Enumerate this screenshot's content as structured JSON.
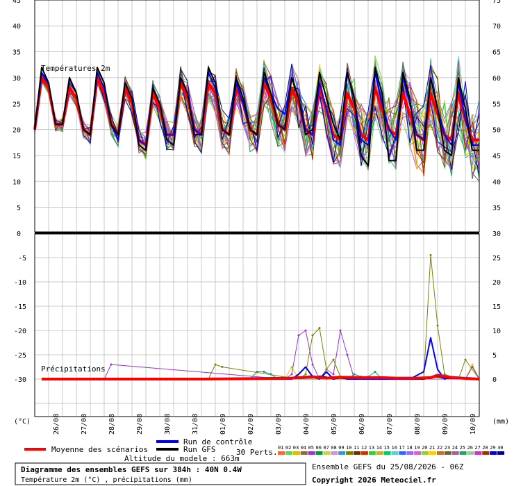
{
  "chart_data": [
    {
      "type": "line",
      "title": "Températures 2m",
      "left_ylim": [
        0,
        45
      ],
      "left_yticks": [
        "0",
        "5",
        "10",
        "15",
        "20",
        "25",
        "30",
        "35",
        "40",
        "45"
      ],
      "right_yticks": [
        "35",
        "40",
        "45",
        "50",
        "55",
        "60",
        "65",
        "70",
        "75"
      ],
      "x_ticks": [
        "26/08",
        "27/08",
        "28/08",
        "29/08",
        "30/08",
        "31/08",
        "01/09",
        "02/09",
        "03/09",
        "04/09",
        "05/09",
        "06/09",
        "07/09",
        "08/09",
        "09/09",
        "10/09"
      ],
      "x_range_h": [
        0,
        384
      ],
      "grid": true,
      "series": [
        {
          "name": "Moyenne des scénarios",
          "color": "#ff0000",
          "x": [
            0,
            6,
            12,
            18,
            24,
            30,
            36,
            42,
            48,
            54,
            60,
            66,
            72,
            78,
            84,
            90,
            96,
            102,
            108,
            114,
            120,
            126,
            132,
            138,
            144,
            150,
            156,
            162,
            168,
            174,
            180,
            186,
            192,
            198,
            204,
            210,
            216,
            222,
            228,
            234,
            240,
            246,
            252,
            258,
            264,
            270,
            276,
            282,
            288,
            294,
            300,
            306,
            312,
            318,
            324,
            330,
            336,
            342,
            348,
            354,
            360,
            366,
            372,
            378,
            384
          ],
          "y": [
            20,
            30,
            28,
            21,
            21,
            28,
            26,
            20,
            19,
            30,
            27,
            21,
            19,
            28,
            25,
            18,
            17,
            27,
            24,
            19,
            19,
            29,
            26,
            20,
            19,
            29,
            27,
            20,
            19,
            28,
            25,
            20,
            19,
            29,
            26,
            21,
            20,
            28,
            25,
            20,
            19,
            28,
            24,
            19,
            18,
            27,
            24,
            19,
            18,
            28,
            24,
            20,
            19,
            27,
            23,
            19,
            18,
            27,
            23,
            19,
            18,
            27,
            22,
            18,
            18
          ]
        },
        {
          "name": "Run de contrôle",
          "color": "#0000ff",
          "x": [
            0,
            6,
            12,
            18,
            24,
            30,
            36,
            42,
            48,
            54,
            60,
            66,
            72,
            78,
            84,
            90,
            96,
            102,
            108,
            114,
            120,
            126,
            132,
            138,
            144,
            150,
            156,
            162,
            168,
            174,
            180,
            186,
            192,
            198,
            204,
            210,
            216,
            222,
            228,
            234,
            240,
            246,
            252,
            258,
            264,
            270,
            276,
            282,
            288,
            294,
            300,
            306,
            312,
            318,
            324,
            330,
            336,
            342,
            348,
            354,
            360,
            366,
            372,
            378,
            384
          ],
          "y": [
            20,
            31,
            29,
            21,
            21,
            30,
            27,
            20,
            19,
            31,
            28,
            21,
            18,
            29,
            26,
            18,
            17,
            28,
            25,
            19,
            19,
            30,
            27,
            20,
            19,
            31,
            28,
            20,
            19,
            29,
            25,
            20,
            19,
            30,
            27,
            24,
            23,
            30,
            26,
            20,
            19,
            29,
            24,
            18,
            17,
            31,
            26,
            18,
            17,
            31,
            25,
            20,
            18,
            30,
            25,
            19,
            18,
            30,
            24,
            19,
            17,
            29,
            22,
            17,
            17
          ]
        },
        {
          "name": "Run GFS",
          "color": "#000000",
          "x": [
            0,
            6,
            12,
            18,
            24,
            30,
            36,
            42,
            48,
            54,
            60,
            66,
            72,
            78,
            84,
            90,
            96,
            102,
            108,
            114,
            120,
            126,
            132,
            138,
            144,
            150,
            156,
            162,
            168,
            174,
            180,
            186,
            192,
            198,
            204,
            210,
            216,
            222,
            228,
            234,
            240,
            246,
            252,
            258,
            264,
            270,
            276,
            282,
            288,
            294,
            300,
            306,
            312,
            318,
            324,
            330,
            336,
            342,
            348,
            354,
            360,
            366,
            372,
            378,
            384
          ],
          "y": [
            20,
            32,
            29,
            21,
            21,
            30,
            27,
            20,
            19,
            32,
            29,
            21,
            19,
            29,
            26,
            17,
            16,
            28,
            25,
            18,
            17,
            30,
            27,
            19,
            19,
            32,
            29,
            20,
            19,
            30,
            26,
            20,
            19,
            31,
            27,
            21,
            20,
            30,
            26,
            19,
            20,
            31,
            26,
            21,
            18,
            31,
            26,
            15,
            13,
            32,
            27,
            14,
            14,
            31,
            26,
            16,
            16,
            30,
            24,
            16,
            15,
            30,
            24,
            16,
            16
          ]
        }
      ]
    },
    {
      "type": "line",
      "title": "Précipitations",
      "left_ylim": [
        -35,
        0
      ],
      "left_yticks": [
        "0",
        "-5",
        "-10",
        "-15",
        "-20",
        "-25",
        "-30"
      ],
      "right_yticks": [
        "30",
        "25",
        "20",
        "15",
        "10",
        "5",
        "0"
      ],
      "x_ticks": [
        "26/08",
        "27/08",
        "28/08",
        "29/08",
        "30/08",
        "31/08",
        "01/09",
        "02/09",
        "03/09",
        "04/09",
        "05/09",
        "06/09",
        "07/09",
        "08/09",
        "09/09",
        "10/09"
      ],
      "x_range_h": [
        0,
        384
      ],
      "grid": true,
      "series": [
        {
          "name": "Moyenne des scénarios",
          "color": "#ff0000",
          "x": [
            6,
            48,
            96,
            144,
            192,
            222,
            240,
            246,
            252,
            264,
            282,
            300,
            312,
            330,
            342,
            348,
            360,
            384
          ],
          "y": [
            0,
            0,
            0,
            0,
            0.1,
            0.2,
            0.5,
            0.3,
            0.2,
            0.4,
            0.3,
            0.3,
            0.2,
            0.2,
            0.3,
            0.8,
            0.3,
            0
          ]
        },
        {
          "name": "Run de contrôle",
          "color": "#0000ff",
          "x": [
            6,
            180,
            204,
            222,
            228,
            234,
            240,
            246,
            252,
            258,
            264,
            270,
            300,
            324,
            336,
            342,
            348,
            354,
            360,
            384
          ],
          "y": [
            0,
            0,
            0,
            0,
            1,
            2.5,
            0.5,
            0,
            1.5,
            0,
            0.5,
            0,
            0,
            0,
            1.5,
            8.5,
            2,
            0,
            0.5,
            0
          ]
        },
        {
          "name": "Run GFS",
          "color": "#000000",
          "x": [
            6,
            96,
            144,
            192,
            240,
            246,
            252,
            258,
            264,
            270,
            300,
            336,
            342,
            348,
            354,
            384
          ],
          "y": [
            0,
            0,
            0,
            0,
            0.3,
            0.6,
            0.4,
            0,
            0.3,
            0,
            0,
            0,
            0.3,
            0.5,
            0.2,
            0
          ]
        },
        {
          "name": "14",
          "color": "#808000",
          "x": [
            6,
            150,
            156,
            162,
            228,
            234,
            240,
            246,
            252,
            258,
            264,
            270,
            336,
            342,
            348,
            354,
            366,
            372,
            384
          ],
          "y": [
            0,
            0,
            3,
            2.5,
            0,
            1,
            9,
            10.5,
            2,
            4,
            0.5,
            0,
            0,
            25.5,
            11,
            1,
            0,
            4,
            0
          ]
        },
        {
          "name": "11",
          "color": "#9933cc",
          "x": [
            6,
            54,
            60,
            66,
            216,
            222,
            228,
            234,
            240,
            246,
            252,
            258,
            264,
            270,
            276,
            282,
            288,
            372,
            378,
            384
          ],
          "y": [
            0,
            0,
            0,
            3,
            0,
            1,
            9,
            10,
            3,
            0,
            2,
            1,
            10,
            5,
            0,
            0,
            0,
            0,
            2.5,
            0
          ]
        },
        {
          "name": "13",
          "color": "#00aa66",
          "x": [
            6,
            270,
            276,
            282,
            288,
            294,
            300,
            384
          ],
          "y": [
            0,
            0,
            1,
            0.5,
            0.5,
            1.5,
            0,
            0
          ]
        },
        {
          "name": "15",
          "color": "#009999",
          "x": [
            6,
            186,
            192,
            198,
            204,
            210,
            384
          ],
          "y": [
            0,
            0,
            1.5,
            1.5,
            1,
            0,
            0
          ]
        },
        {
          "name": "16",
          "color": "#ddcc00",
          "x": [
            6,
            210,
            216,
            222,
            228,
            372,
            378,
            384
          ],
          "y": [
            0,
            0,
            0,
            2.5,
            0,
            0,
            3,
            0
          ]
        }
      ]
    }
  ],
  "axis": {
    "left_unit": "(°C)",
    "right_unit": "(mm)"
  },
  "legend": {
    "mean": "Moyenne des scénarios",
    "control": "Run de contrôle",
    "gfs": "Run GFS",
    "perts": "30 Perts.",
    "altitude": "Altitude du modele : 663m",
    "pert_labels": [
      "01",
      "02",
      "03",
      "04",
      "05",
      "06",
      "07",
      "08",
      "09",
      "10",
      "11",
      "12",
      "13",
      "14",
      "15",
      "16",
      "17",
      "18",
      "19",
      "20",
      "21",
      "22",
      "23",
      "24",
      "25",
      "26",
      "27",
      "28",
      "29",
      "30"
    ],
    "pert_colors": [
      "#ff6633",
      "#66cc66",
      "#ddbb00",
      "#996633",
      "#9933cc",
      "#009933",
      "#cccc66",
      "#cc99cc",
      "#3399cc",
      "#808000",
      "#663300",
      "#cc3300",
      "#33cc33",
      "#ccaa33",
      "#00cc66",
      "#66cccc",
      "#3366ff",
      "#9966ff",
      "#cc66cc",
      "#99cc33",
      "#ffcc00",
      "#cc6633",
      "#666633",
      "#996699",
      "#339966",
      "#99cc99",
      "#cc33cc",
      "#993300",
      "#0000cc",
      "#000099"
    ]
  },
  "footer": {
    "title": "Diagramme des ensembles GEFS sur 384h : 40N 0.4W",
    "subtitle": "Température 2m (°C) , précipitations (mm)",
    "run": "Ensemble GEFS du 25/08/2026 - 06Z",
    "copyright": "Copyright 2026 Meteociel.fr"
  },
  "colors": {
    "mean": "#ff0000",
    "control": "#0000ff",
    "gfs": "#000000",
    "grid": "#c8c8c8"
  }
}
